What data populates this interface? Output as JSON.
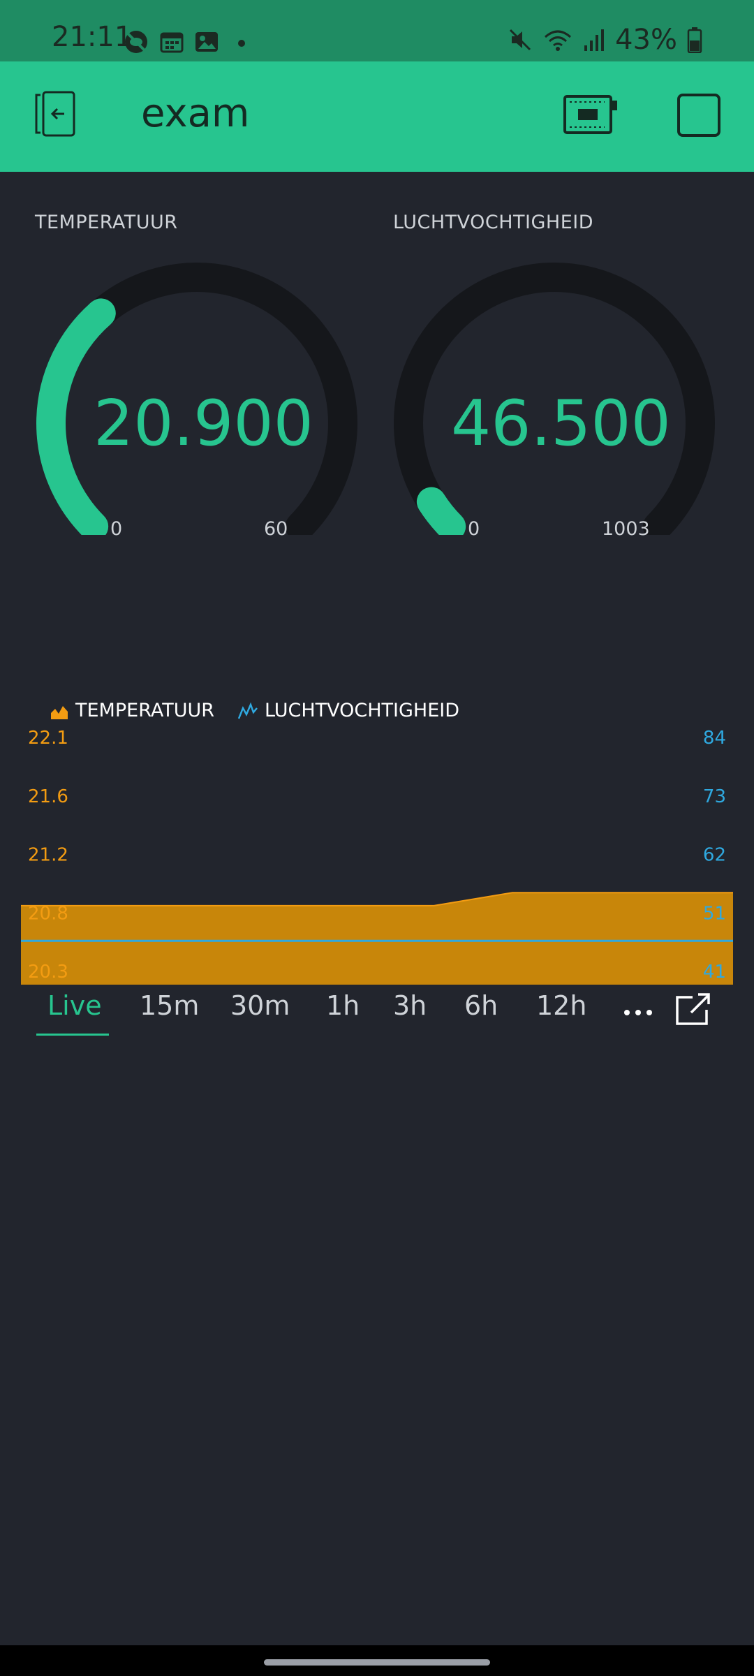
{
  "status_bar": {
    "time": "21:11",
    "battery": "43%",
    "icons": [
      "eye-off-icon",
      "calendar-icon",
      "image-icon",
      "dot-icon",
      "mute-icon",
      "wifi-icon",
      "signal-icon",
      "battery-icon"
    ]
  },
  "app_bar": {
    "title": "exam",
    "icons": [
      "exit-icon",
      "device-icon",
      "square-icon"
    ]
  },
  "gauges": [
    {
      "label": "TEMPERATUUR",
      "value": "20.900",
      "min": "0",
      "max": "60",
      "level": 0.348
    },
    {
      "label": "LUCHTVOCHTIGHEID",
      "value": "46.500",
      "min": "0",
      "max": "1003",
      "level": 0.046
    }
  ],
  "legend": [
    {
      "name": "TEMPERATUUR",
      "icon": "area-chart-icon",
      "color": "#f39c12"
    },
    {
      "name": "LUCHTVOCHTIGHEID",
      "icon": "line-chart-icon",
      "color": "#2fa9e0"
    }
  ],
  "chart_data": {
    "type": "area",
    "series": [
      {
        "name": "TEMPERATUUR",
        "axis": "left",
        "x": [
          0,
          0.58,
          0.69,
          1
        ],
        "values": [
          20.8,
          20.8,
          20.9,
          20.9
        ]
      },
      {
        "name": "LUCHTVOCHTIGHEID",
        "axis": "right",
        "x": [
          0,
          1
        ],
        "values": [
          46.5,
          46.5
        ]
      }
    ],
    "y_left_ticks": [
      "22.1",
      "21.6",
      "21.2",
      "20.8",
      "20.3"
    ],
    "y_right_ticks": [
      "84",
      "73",
      "62",
      "51",
      "41"
    ],
    "y_left_range": [
      20.3,
      22.1
    ],
    "y_right_range": [
      41,
      84
    ],
    "grid": false
  },
  "time_tabs": {
    "items": [
      "Live",
      "15m",
      "30m",
      "1h",
      "3h",
      "6h",
      "12h"
    ],
    "active": "Live",
    "more_icon": "more-horizontal-icon",
    "expand_icon": "external-expand-icon"
  },
  "colors": {
    "status_bar": "#1f8c63",
    "app_bar": "#27c58f",
    "background": "#22252d",
    "accent": "#27c58f",
    "temperature": "#f39c12",
    "humidity": "#2fa9e0",
    "area_fill": "#c8860a"
  }
}
